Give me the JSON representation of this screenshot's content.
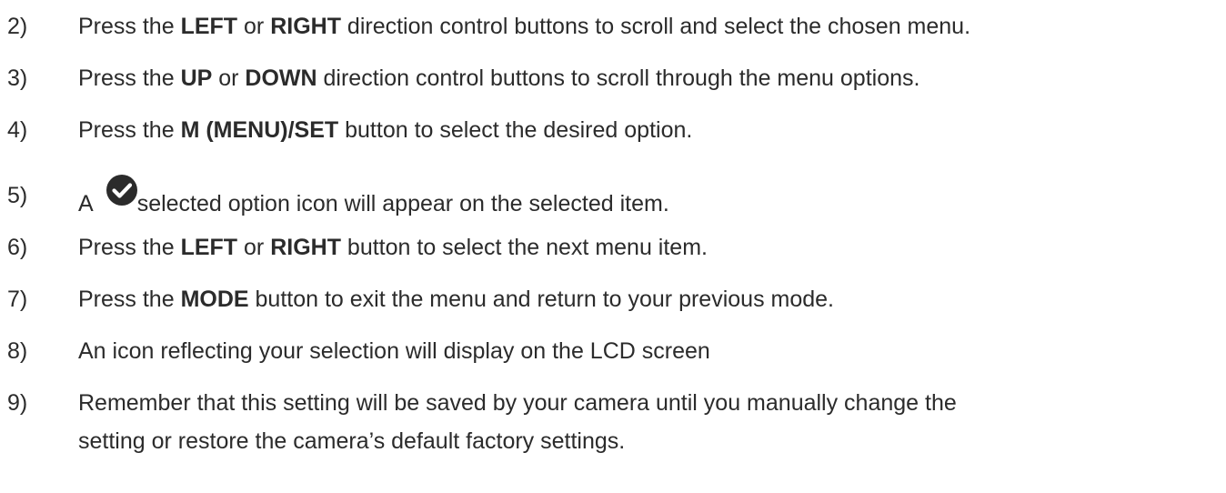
{
  "steps": [
    {
      "num": "2)",
      "a": "Press the ",
      "b1": "LEFT",
      "c": " or ",
      "b2": "RIGHT",
      "d": " direction control buttons to scroll and select the chosen menu."
    },
    {
      "num": "3)",
      "a": "Press the ",
      "b1": "UP",
      "c": " or ",
      "b2": "DOWN",
      "d": " direction control buttons to scroll through the menu options."
    },
    {
      "num": "4)",
      "a": "Press the ",
      "b1": "M (MENU)/SET",
      "d": " button to select the desired option."
    },
    {
      "num": "5)",
      "a": "A",
      "icon": "check-circle-icon",
      "d": "selected option icon will appear on the selected item."
    },
    {
      "num": "6)",
      "a": "Press the ",
      "b1": "LEFT",
      "c": " or ",
      "b2": "RIGHT",
      "d": " button to select the next menu item."
    },
    {
      "num": "7)",
      "a": "Press the ",
      "b1": "MODE",
      "d": " button to exit the menu and return to your previous mode."
    },
    {
      "num": "8)",
      "a": "An icon reflecting your selection will display on the LCD screen"
    },
    {
      "num": "9)",
      "a": "Remember that this setting will be saved by your camera until you manually change the",
      "line2": "setting or restore the camera’s default factory settings."
    }
  ]
}
